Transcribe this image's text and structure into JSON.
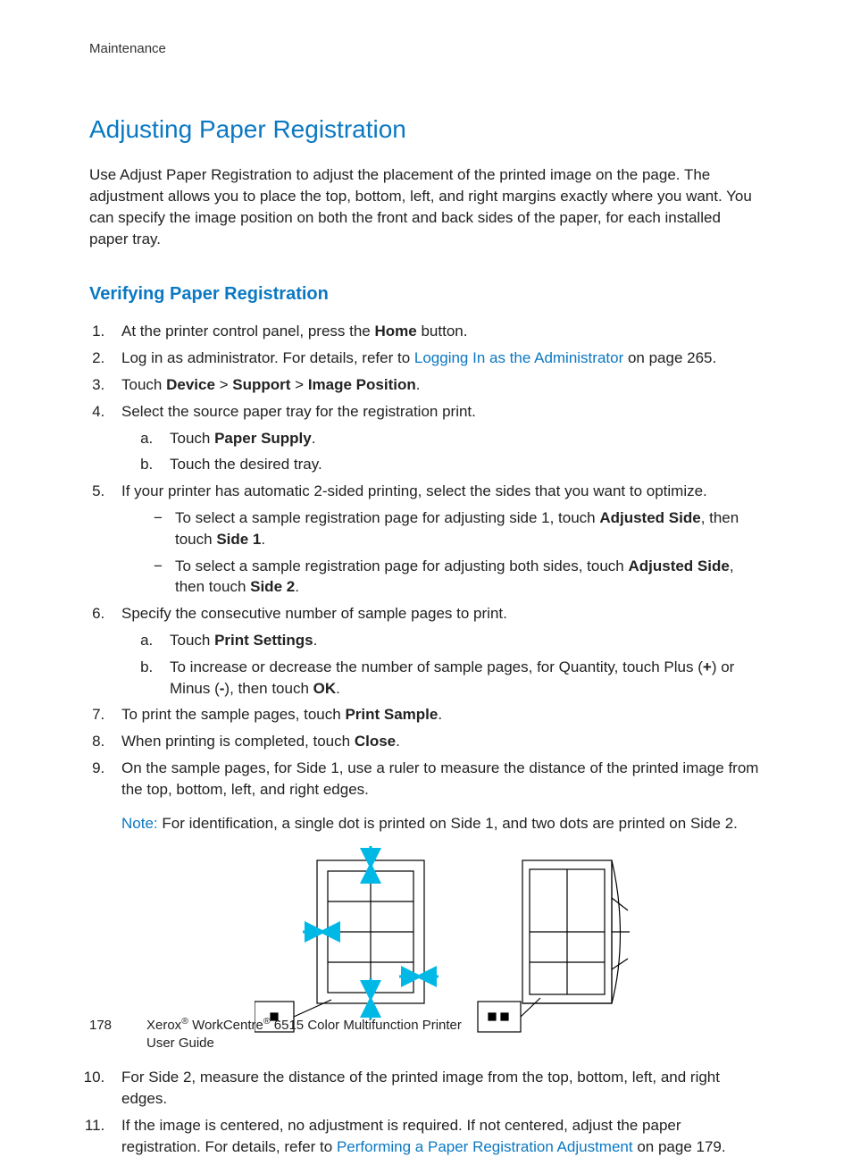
{
  "header": {
    "running": "Maintenance"
  },
  "title": "Adjusting Paper Registration",
  "intro": "Use Adjust Paper Registration to adjust the placement of the printed image on the page. The adjustment allows you to place the top, bottom, left, and right margins exactly where you want. You can specify the image position on both the front and back sides of the paper, for each installed paper tray.",
  "subheading": "Verifying Paper Registration",
  "steps": {
    "s1_a": "At the printer control panel, press the ",
    "s1_b": "Home",
    "s1_c": " button.",
    "s2_a": "Log in as administrator. For details, refer to ",
    "s2_link": "Logging In as the Administrator",
    "s2_b": " on page 265.",
    "s3_a": "Touch ",
    "s3_b": "Device",
    "s3_c": " > ",
    "s3_d": "Support",
    "s3_e": " > ",
    "s3_f": "Image Position",
    "s3_g": ".",
    "s4": "Select the source paper tray for the registration print.",
    "s4a_a": "Touch ",
    "s4a_b": "Paper Supply",
    "s4a_c": ".",
    "s4b": "Touch the desired tray.",
    "s5": "If your printer has automatic 2-sided printing, select the sides that you want to optimize.",
    "s5d1_a": "To select a sample registration page for adjusting side 1, touch ",
    "s5d1_b": "Adjusted Side",
    "s5d1_c": ", then touch ",
    "s5d1_d": "Side 1",
    "s5d1_e": ".",
    "s5d2_a": "To select a sample registration page for adjusting both sides, touch ",
    "s5d2_b": "Adjusted Side",
    "s5d2_c": ", then touch ",
    "s5d2_d": "Side 2",
    "s5d2_e": ".",
    "s6": "Specify the consecutive number of sample pages to print.",
    "s6a_a": "Touch ",
    "s6a_b": "Print Settings",
    "s6a_c": ".",
    "s6b_a": "To increase or decrease the number of sample pages, for Quantity, touch Plus (",
    "s6b_b": "+",
    "s6b_c": ") or Minus (",
    "s6b_d": "-",
    "s6b_e": "), then touch ",
    "s6b_f": "OK",
    "s6b_g": ".",
    "s7_a": "To print the sample pages, touch ",
    "s7_b": "Print Sample",
    "s7_c": ".",
    "s8_a": "When printing is completed, touch ",
    "s8_b": "Close",
    "s8_c": ".",
    "s9": "On the sample pages, for Side 1, use a ruler to measure the distance of the printed image from the top, bottom, left, and right edges.",
    "note_label": "Note:",
    "note_text": " For identification, a single dot is printed on Side 1, and two dots are printed on Side 2.",
    "s10": "For Side 2, measure the distance of the printed image from the top, bottom, left, and right edges.",
    "s11_a": "If the image is centered, no adjustment is required. If not centered, adjust the paper registration. For details, refer to ",
    "s11_link": "Performing a Paper Registration Adjustment",
    "s11_b": " on page 179."
  },
  "footer": {
    "page": "178",
    "line1": "Xerox® WorkCentre® 6515 Color Multifunction Printer",
    "line2": "User Guide"
  }
}
